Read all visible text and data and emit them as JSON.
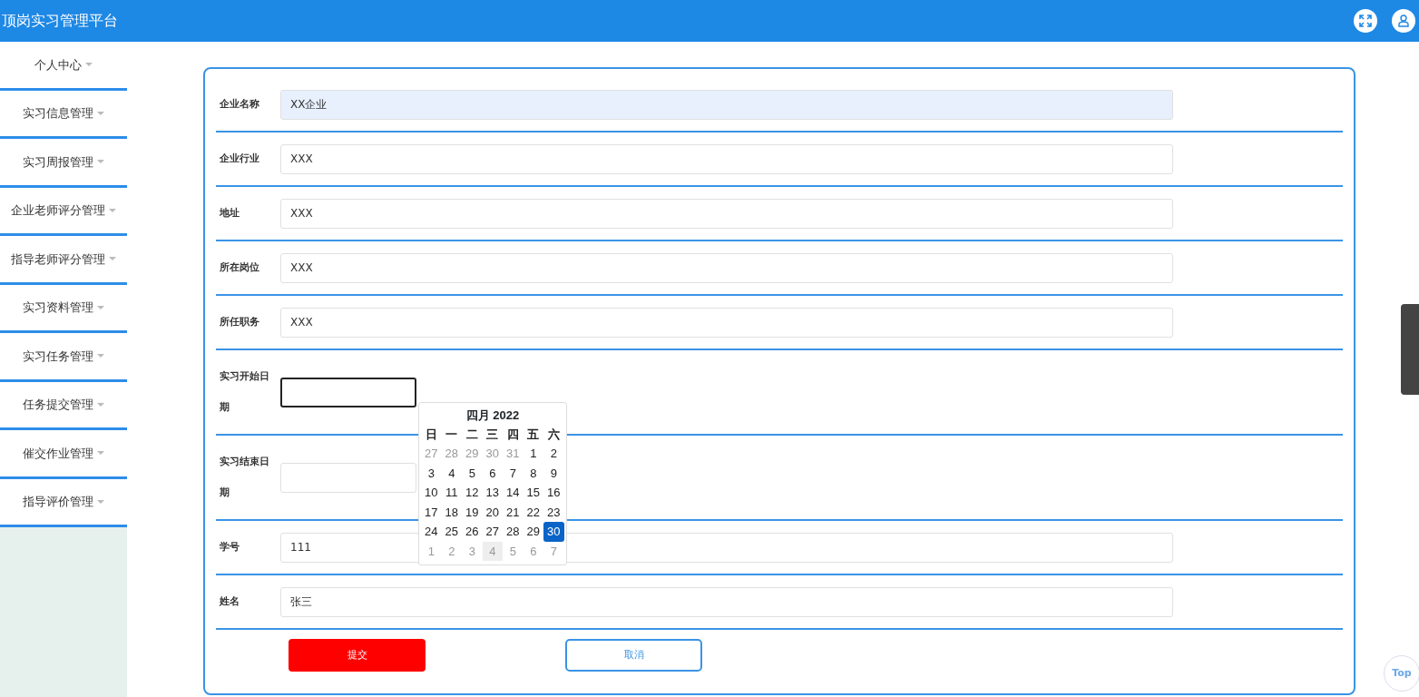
{
  "header": {
    "title": "顶岗实习管理平台"
  },
  "sidebar": {
    "items": [
      {
        "label": "个人中心"
      },
      {
        "label": "实习信息管理"
      },
      {
        "label": "实习周报管理"
      },
      {
        "label": "企业老师评分管理"
      },
      {
        "label": "指导老师评分管理"
      },
      {
        "label": "实习资料管理"
      },
      {
        "label": "实习任务管理"
      },
      {
        "label": "任务提交管理"
      },
      {
        "label": "催交作业管理"
      },
      {
        "label": "指导评价管理"
      }
    ]
  },
  "form": {
    "fields": [
      {
        "label": "企业名称",
        "value": "XX企业",
        "kind": "text",
        "autofilled": true,
        "focused": false
      },
      {
        "label": "企业行业",
        "value": "XXX",
        "kind": "text",
        "autofilled": false,
        "focused": false
      },
      {
        "label": "地址",
        "value": "XXX",
        "kind": "text",
        "autofilled": false,
        "focused": false
      },
      {
        "label": "所在岗位",
        "value": "XXX",
        "kind": "text",
        "autofilled": false,
        "focused": false
      },
      {
        "label": "所任职务",
        "value": "XXX",
        "kind": "text",
        "autofilled": false,
        "focused": false
      },
      {
        "label": "实习开始日期",
        "kind": "date",
        "autofilled": false,
        "focused": true
      },
      {
        "label": "实习结束日期",
        "kind": "date",
        "autofilled": false,
        "focused": false
      },
      {
        "label": "学号",
        "value": "111",
        "kind": "text",
        "autofilled": false,
        "focused": false
      },
      {
        "label": "姓名",
        "value": "张三",
        "kind": "text",
        "autofilled": false,
        "focused": false
      }
    ],
    "buttons": [
      {
        "label": "提交",
        "kind": "primary"
      },
      {
        "label": "取消",
        "kind": "secondary"
      }
    ]
  },
  "calendar": {
    "title": "四月 2022",
    "weekdays": [
      "日",
      "一",
      "二",
      "三",
      "四",
      "五",
      "六"
    ],
    "weeks": [
      [
        {
          "day": "27",
          "other_month": true,
          "selected": false,
          "hovered": false
        },
        {
          "day": "28",
          "other_month": true,
          "selected": false,
          "hovered": false
        },
        {
          "day": "29",
          "other_month": true,
          "selected": false,
          "hovered": false
        },
        {
          "day": "30",
          "other_month": true,
          "selected": false,
          "hovered": false
        },
        {
          "day": "31",
          "other_month": true,
          "selected": false,
          "hovered": false
        },
        {
          "day": "1",
          "other_month": false,
          "selected": false,
          "hovered": false
        },
        {
          "day": "2",
          "other_month": false,
          "selected": false,
          "hovered": false
        }
      ],
      [
        {
          "day": "3",
          "other_month": false,
          "selected": false,
          "hovered": false
        },
        {
          "day": "4",
          "other_month": false,
          "selected": false,
          "hovered": false
        },
        {
          "day": "5",
          "other_month": false,
          "selected": false,
          "hovered": false
        },
        {
          "day": "6",
          "other_month": false,
          "selected": false,
          "hovered": false
        },
        {
          "day": "7",
          "other_month": false,
          "selected": false,
          "hovered": false
        },
        {
          "day": "8",
          "other_month": false,
          "selected": false,
          "hovered": false
        },
        {
          "day": "9",
          "other_month": false,
          "selected": false,
          "hovered": false
        }
      ],
      [
        {
          "day": "10",
          "other_month": false,
          "selected": false,
          "hovered": false
        },
        {
          "day": "11",
          "other_month": false,
          "selected": false,
          "hovered": false
        },
        {
          "day": "12",
          "other_month": false,
          "selected": false,
          "hovered": false
        },
        {
          "day": "13",
          "other_month": false,
          "selected": false,
          "hovered": false
        },
        {
          "day": "14",
          "other_month": false,
          "selected": false,
          "hovered": false
        },
        {
          "day": "15",
          "other_month": false,
          "selected": false,
          "hovered": false
        },
        {
          "day": "16",
          "other_month": false,
          "selected": false,
          "hovered": false
        }
      ],
      [
        {
          "day": "17",
          "other_month": false,
          "selected": false,
          "hovered": false
        },
        {
          "day": "18",
          "other_month": false,
          "selected": false,
          "hovered": false
        },
        {
          "day": "19",
          "other_month": false,
          "selected": false,
          "hovered": false
        },
        {
          "day": "20",
          "other_month": false,
          "selected": false,
          "hovered": false
        },
        {
          "day": "21",
          "other_month": false,
          "selected": false,
          "hovered": false
        },
        {
          "day": "22",
          "other_month": false,
          "selected": false,
          "hovered": false
        },
        {
          "day": "23",
          "other_month": false,
          "selected": false,
          "hovered": false
        }
      ],
      [
        {
          "day": "24",
          "other_month": false,
          "selected": false,
          "hovered": false
        },
        {
          "day": "25",
          "other_month": false,
          "selected": false,
          "hovered": false
        },
        {
          "day": "26",
          "other_month": false,
          "selected": false,
          "hovered": false
        },
        {
          "day": "27",
          "other_month": false,
          "selected": false,
          "hovered": false
        },
        {
          "day": "28",
          "other_month": false,
          "selected": false,
          "hovered": false
        },
        {
          "day": "29",
          "other_month": false,
          "selected": false,
          "hovered": false
        },
        {
          "day": "30",
          "other_month": false,
          "selected": true,
          "hovered": false
        }
      ],
      [
        {
          "day": "1",
          "other_month": true,
          "selected": false,
          "hovered": false
        },
        {
          "day": "2",
          "other_month": true,
          "selected": false,
          "hovered": false
        },
        {
          "day": "3",
          "other_month": true,
          "selected": false,
          "hovered": false
        },
        {
          "day": "4",
          "other_month": true,
          "selected": false,
          "hovered": true
        },
        {
          "day": "5",
          "other_month": true,
          "selected": false,
          "hovered": false
        },
        {
          "day": "6",
          "other_month": true,
          "selected": false,
          "hovered": false
        },
        {
          "day": "7",
          "other_month": true,
          "selected": false,
          "hovered": false
        }
      ]
    ]
  },
  "back_to_top": {
    "label": "Top"
  }
}
